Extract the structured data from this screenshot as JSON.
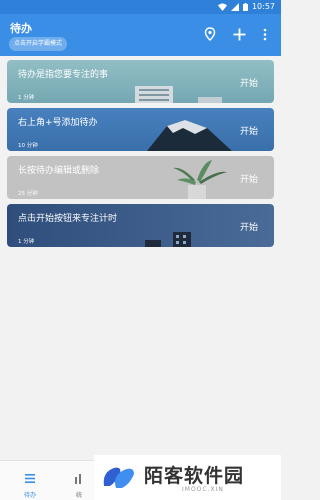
{
  "status_bar": {
    "time": "10:57"
  },
  "app_bar": {
    "title": "待办",
    "study_mode_button": "点击开启学霸模式",
    "icons": [
      "location-pin-icon",
      "plus-icon",
      "more-vert-icon"
    ]
  },
  "tasks": [
    {
      "title": "待办是指您要专注的事",
      "duration": "1 分钟",
      "start_label": "开始",
      "theme": "buildings-teal"
    },
    {
      "title": "右上角+号添加待办",
      "duration": "10 分钟",
      "start_label": "开始",
      "theme": "mountain-blue"
    },
    {
      "title": "长按待办编辑或删除",
      "duration": "25 分钟",
      "start_label": "开始",
      "theme": "plant-gray"
    },
    {
      "title": "点击开始按钮来专注计时",
      "duration": "1 分钟",
      "start_label": "开始",
      "theme": "city-night"
    }
  ],
  "bottom_nav": [
    {
      "label": "待办",
      "icon": "list-icon",
      "active": true
    },
    {
      "label": "统",
      "icon": "stats-icon",
      "active": false
    }
  ],
  "watermark": {
    "name": "陌客软件园",
    "domain": "IMOOC.XIN"
  },
  "colors": {
    "primary": "#3a8ee6",
    "status_bar": "#2f80d9"
  }
}
